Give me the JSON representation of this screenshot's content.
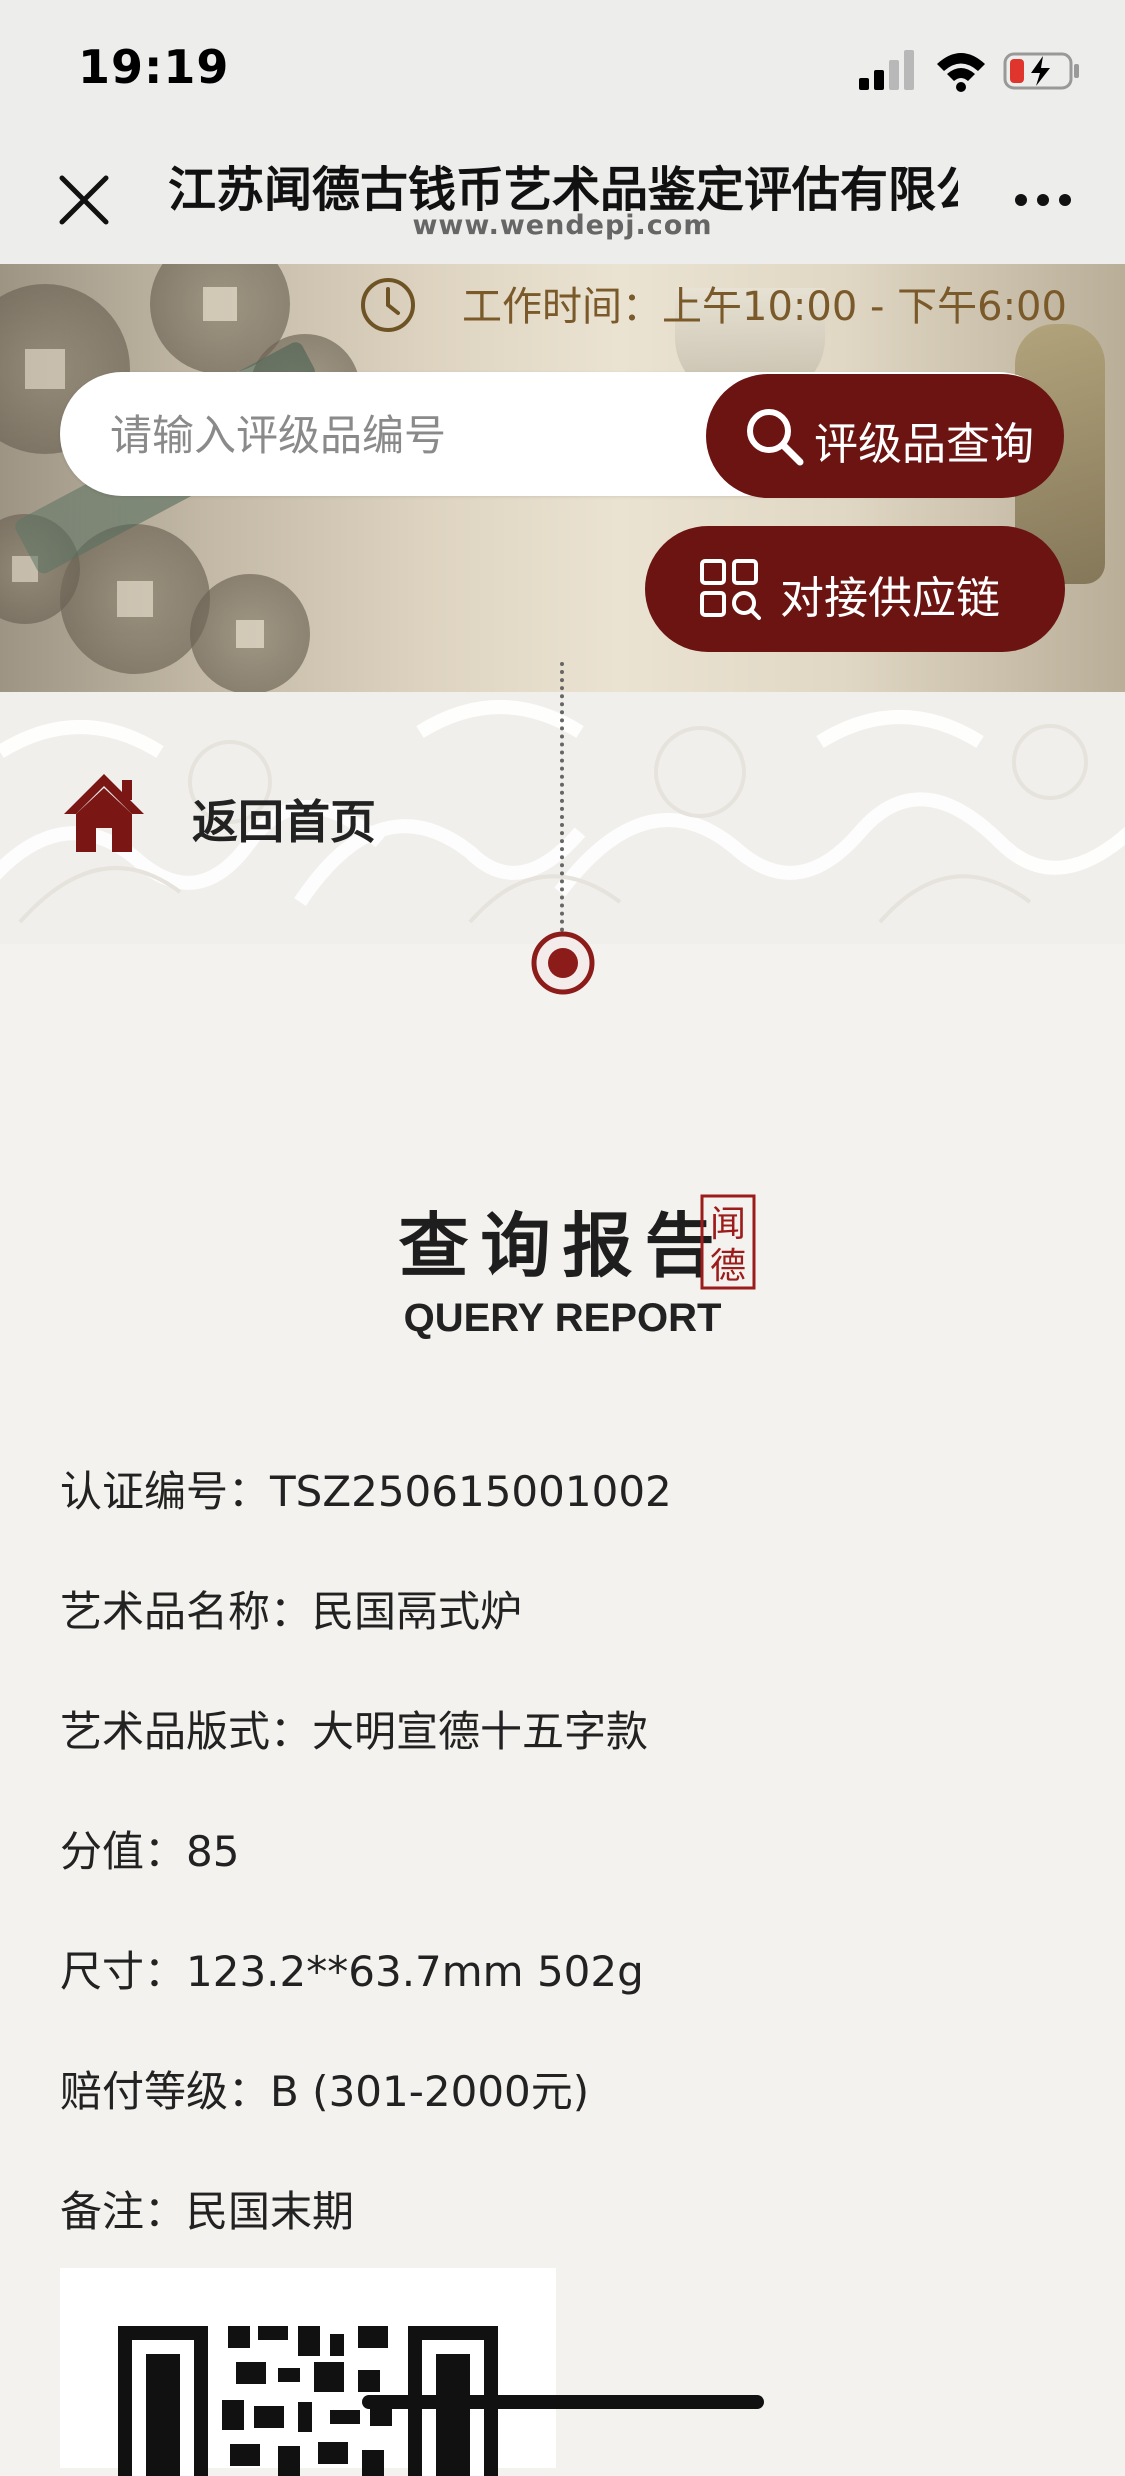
{
  "status_bar": {
    "time": "19:19"
  },
  "nav": {
    "title": "江苏闻德古钱币艺术品鉴定评估有限公司",
    "url": "www.wendepj.com"
  },
  "hero": {
    "work_time": "工作时间：上午10:00 - 下午6:00",
    "search": {
      "placeholder": "请输入评级品编号",
      "value": ""
    },
    "query_button": "评级品查询",
    "supply_button": "对接供应链"
  },
  "home_link": {
    "label": "返回首页"
  },
  "report": {
    "title_cn": "查询报告",
    "seal_text": "闻德",
    "title_en": "QUERY REPORT",
    "fields": [
      {
        "label": "认证编号：",
        "value": "TSZ250615001002"
      },
      {
        "label": "艺术品名称：",
        "value": "民国鬲式炉"
      },
      {
        "label": "艺术品版式：",
        "value": "大明宣德十五字款"
      },
      {
        "label": "分值：",
        "value": "85"
      },
      {
        "label": "尺寸：",
        "value": "123.2**63.7mm 502g"
      },
      {
        "label": "赔付等级：",
        "value": "B (301-2000元)"
      },
      {
        "label": "备注：",
        "value": "民国末期"
      }
    ]
  },
  "icons": {
    "close": "close-icon",
    "more": "more-icon",
    "clock": "clock-icon",
    "search": "search-icon",
    "grid_search": "grid-search-icon",
    "home": "home-icon",
    "location_pin": "pin-icon",
    "qr_code": "qr-code"
  },
  "colors": {
    "brand": "#6b1411",
    "background": "#f3f2ef",
    "gold_text": "#7a5a2a"
  }
}
